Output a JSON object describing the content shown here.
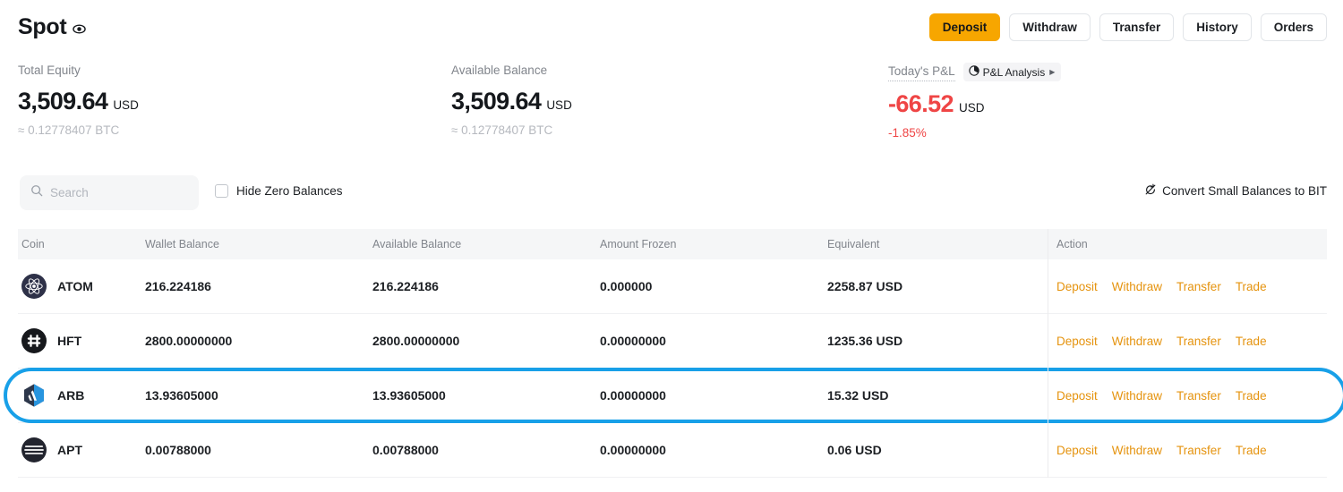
{
  "header": {
    "title": "Spot",
    "eye_icon": "eye-icon",
    "buttons": [
      {
        "label": "Deposit",
        "primary": true
      },
      {
        "label": "Withdraw",
        "primary": false
      },
      {
        "label": "Transfer",
        "primary": false
      },
      {
        "label": "History",
        "primary": false
      },
      {
        "label": "Orders",
        "primary": false
      }
    ]
  },
  "summary": {
    "total_equity": {
      "label": "Total Equity",
      "value": "3,509.64",
      "currency": "USD",
      "sub": "≈ 0.12778407 BTC"
    },
    "available_balance": {
      "label": "Available Balance",
      "value": "3,509.64",
      "currency": "USD",
      "sub": "≈ 0.12778407 BTC"
    },
    "todays_pnl": {
      "label": "Today's P&L",
      "badge_label": "P&L Analysis",
      "badge_icon": "pie-chart-icon",
      "badge_caret": "▶",
      "value": "-66.52",
      "currency": "USD",
      "sub": "-1.85%",
      "negative_color": "#ef4545"
    }
  },
  "filters": {
    "search_placeholder": "Search",
    "search_value": "",
    "search_icon": "search-icon",
    "hide_zero_label": "Hide Zero Balances",
    "hide_zero_checked": false,
    "convert_label": "Convert Small Balances to BIT",
    "convert_icon": "convert-icon"
  },
  "table": {
    "columns": [
      "Coin",
      "Wallet Balance",
      "Available Balance",
      "Amount Frozen",
      "Equivalent",
      "Action"
    ],
    "action_links": [
      "Deposit",
      "Withdraw",
      "Transfer",
      "Trade"
    ],
    "rows": [
      {
        "coin": "ATOM",
        "icon": "atom-coin-icon",
        "wallet_balance": "216.224186",
        "available_balance": "216.224186",
        "amount_frozen": "0.000000",
        "equivalent": "2258.87 USD",
        "highlighted": false
      },
      {
        "coin": "HFT",
        "icon": "hft-coin-icon",
        "wallet_balance": "2800.00000000",
        "available_balance": "2800.00000000",
        "amount_frozen": "0.00000000",
        "equivalent": "1235.36 USD",
        "highlighted": false
      },
      {
        "coin": "ARB",
        "icon": "arb-coin-icon",
        "wallet_balance": "13.93605000",
        "available_balance": "13.93605000",
        "amount_frozen": "0.00000000",
        "equivalent": "15.32 USD",
        "highlighted": true
      },
      {
        "coin": "APT",
        "icon": "apt-coin-icon",
        "wallet_balance": "0.00788000",
        "available_balance": "0.00788000",
        "amount_frozen": "0.00000000",
        "equivalent": "0.06 USD",
        "highlighted": false
      }
    ]
  },
  "colors": {
    "accent_orange": "#f7a600",
    "action_link": "#e5930e",
    "highlight_blue": "#18a0e8",
    "negative_red": "#ef4545"
  }
}
